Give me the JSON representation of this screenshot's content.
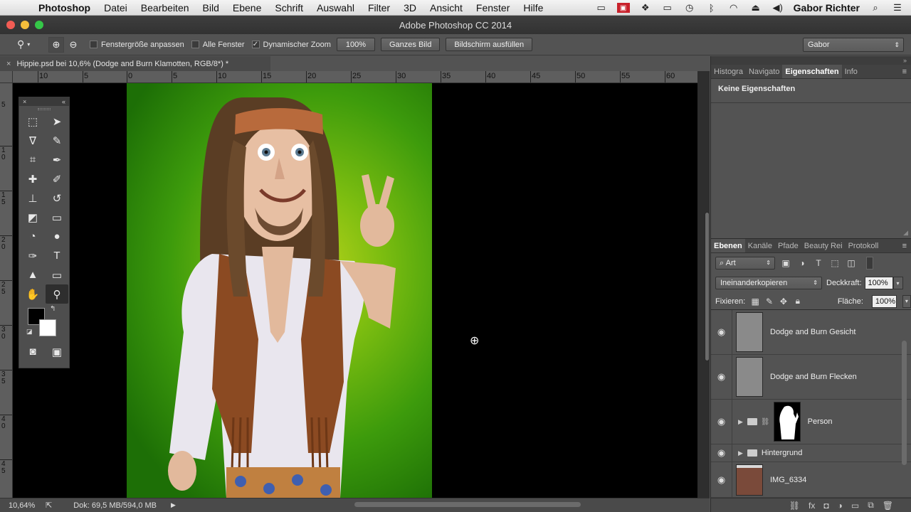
{
  "menubar": {
    "app": "Photoshop",
    "items": [
      "Datei",
      "Bearbeiten",
      "Bild",
      "Ebene",
      "Schrift",
      "Auswahl",
      "Filter",
      "3D",
      "Ansicht",
      "Fenster",
      "Hilfe"
    ],
    "user": "Gabor Richter",
    "tray_icons": [
      "display-icon",
      "red-app-icon",
      "dropbox-icon",
      "airplay-icon",
      "time-machine-icon",
      "bluetooth-icon",
      "wifi-icon",
      "eject-icon",
      "volume-icon"
    ]
  },
  "window": {
    "title": "Adobe Photoshop CC 2014"
  },
  "options": {
    "fit_window": "Fenstergröße anpassen",
    "all_windows": "Alle Fenster",
    "scrubby_zoom": "Dynamischer Zoom",
    "btn_100": "100%",
    "btn_fit": "Ganzes Bild",
    "btn_fill": "Bildschirm ausfüllen",
    "workspace": "Gabor"
  },
  "document": {
    "tab_title": "Hippie.psd bei 10,6% (Dodge and Burn Klamotten, RGB/8*) *",
    "ruler_labels": [
      "10",
      "5",
      "0",
      "5",
      "10",
      "15",
      "20",
      "25",
      "30",
      "35",
      "40",
      "45",
      "50",
      "55",
      "60"
    ],
    "vruler_labels": [
      "5",
      "1 0",
      "1 5",
      "2 0",
      "2 5",
      "3 0",
      "3 5",
      "4 0",
      "4 5"
    ]
  },
  "status": {
    "zoom": "10,64%",
    "doc_size": "Dok: 69,5 MB/594,0 MB"
  },
  "panels": {
    "top_tabs": [
      "Histogra",
      "Navigato",
      "Eigenschaften",
      "Info"
    ],
    "properties_title": "Keine Eigenschaften",
    "layer_tabs": [
      "Ebenen",
      "Kanäle",
      "Pfade",
      "Beauty Rei",
      "Protokoll"
    ],
    "filter_kind": "Art",
    "blend_mode": "Ineinanderkopieren",
    "opacity_label": "Deckkraft:",
    "opacity": "100%",
    "lock_label": "Fixieren:",
    "fill_label": "Fläche:",
    "fill": "100%",
    "layers": [
      {
        "name": "Dodge and Burn Gesicht"
      },
      {
        "name": "Dodge and Burn Flecken"
      },
      {
        "name": "Person"
      },
      {
        "name": "Hintergrund"
      },
      {
        "name": "IMG_6334"
      }
    ]
  }
}
